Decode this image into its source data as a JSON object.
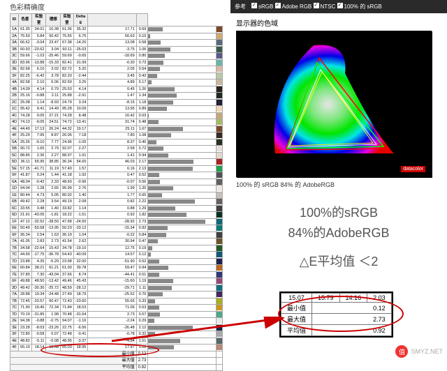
{
  "leftTitle": "色彩精确度",
  "headers": [
    "ID",
    "色差",
    "实验室",
    "理想",
    "实验室",
    "Delta E"
  ],
  "rows": [
    [
      "1A",
      "61.35",
      "34.01",
      "10.38",
      "61.36",
      "35.32",
      "17.71",
      "0.69",
      "#7a4a2a"
    ],
    [
      "2A",
      "75.50",
      "5.84",
      "50.42",
      "75.55",
      "6.75",
      "56.63",
      "0.10",
      "#d1a772"
    ],
    [
      "3A",
      "66.62",
      "-3.04",
      "23.47",
      "67.38",
      "-14.20",
      "13.08",
      "0.58",
      "#5a6a7a"
    ],
    [
      "3B",
      "60.93",
      "-23.62",
      "3.04",
      "60.11",
      "-25.03",
      "-3.75",
      "1.06",
      "#3a5a4a"
    ],
    [
      "3C",
      "59.66",
      "-1.03",
      "-25.46",
      "59.69",
      "-0.65",
      "-18.69",
      "0.80",
      "#5a5a8a"
    ],
    [
      "3D",
      "83.96",
      "-13.88",
      "-15.33",
      "82.41",
      "31.99",
      "-0.30",
      "0.73",
      "#6ab5a5"
    ],
    [
      "3E",
      "82.68",
      "6.10",
      "3.02",
      "82.72",
      "5.20",
      "2.05",
      "0.54",
      "#d8b8a8"
    ],
    [
      "3F",
      "82.25",
      "-6.42",
      "3.78",
      "82.20",
      "-2.44",
      "3.45",
      "0.42",
      "#b8c8a8"
    ],
    [
      "4A",
      "82.58",
      "2.10",
      "6.06",
      "82.59",
      "3.25",
      "4.89",
      "0.17",
      "#c8b8a0"
    ],
    [
      "4B",
      "14.09",
      "4.14",
      "0.79",
      "25.53",
      "4.14",
      "0.45",
      "1.26",
      "#2a2020"
    ],
    [
      "2B",
      "25.16",
      "-0.88",
      "2.11",
      "25.88",
      "-2.91",
      "1.47",
      "1.34",
      "#202820"
    ],
    [
      "2C",
      "25.08",
      "1.14",
      "-8.93",
      "24.79",
      "3.24",
      "-8.15",
      "1.18",
      "#202038"
    ],
    [
      "1C",
      "95.42",
      "9.41",
      "14.49",
      "95.28",
      "10.09",
      "13.95",
      "0.89",
      "#f0d8b8"
    ],
    [
      "4C",
      "74.28",
      "9.05",
      "27.21",
      "74.28",
      "8.48",
      "16.42",
      "0.03",
      "#c8a878"
    ],
    [
      "4D",
      "74.13",
      "-9.05",
      "24.51",
      "74.72",
      "-13.41",
      "31.74",
      "0.48",
      "#a8b868"
    ],
    [
      "4E",
      "44.49",
      "17.13",
      "26.24",
      "44.32",
      "19.17",
      "25.11",
      "1.67",
      "#7a4a2a"
    ],
    [
      "4F",
      "25.29",
      "7.95",
      "8.87",
      "26.06",
      "7.18",
      "7.80",
      "1.08",
      "#3a2820"
    ],
    [
      "5A",
      "25.26",
      "-9.10",
      "7.77",
      "24.96",
      "-1.05",
      "8.37",
      "0.40",
      "#283020"
    ],
    [
      "5B",
      "90.72",
      "1.65",
      "2.79",
      "92.07",
      "2.27",
      "2.58",
      "0.72",
      "#e8e0d8"
    ],
    [
      "5C",
      "88.85",
      "2.36",
      "2.27",
      "88.97",
      "1.91",
      "1.41",
      "0.94",
      "#e0d8d0"
    ],
    [
      "5D",
      "36.11",
      "65.95",
      "38.85",
      "36.34",
      "54.65",
      "46.03",
      "2.17",
      "#a82020"
    ],
    [
      "5E",
      "57.15",
      "-41.71",
      "11.19",
      "57.40",
      "1.57",
      "6.16",
      "2.13",
      "#20a050"
    ],
    [
      "5F",
      "41.87",
      "0.24",
      "1.44",
      "41.18",
      "1.92",
      "0.47",
      "0.52",
      "#505058"
    ],
    [
      "6A",
      "48.04",
      "-0.42",
      "2.33",
      "48.60",
      "-0.96",
      "-0.07",
      "0.56",
      "#606060"
    ],
    [
      "1D",
      "94.04",
      "1.28",
      "2.65",
      "95.99",
      "2.76",
      "1.99",
      "1.20",
      "#f0e8e0"
    ],
    [
      "1E",
      "80.44",
      "4.73",
      "5.05",
      "80.02",
      "1.40",
      "1.77",
      "0.65",
      "#c8c0b8"
    ],
    [
      "6B",
      "49.42",
      "2.28",
      "3.54",
      "49.19",
      "2.08",
      "0.82",
      "2.22",
      "#686060"
    ],
    [
      "6C",
      "33.55",
      "3.48",
      "1.40",
      "33.82",
      "1.14",
      "0.88",
      "1.29",
      "#404040"
    ],
    [
      "6D",
      "21.91",
      "-43.05",
      "-1.81",
      "18.22",
      "-1.51",
      "0.92",
      "1.82",
      "#083020"
    ],
    [
      "1F",
      "47.12",
      "-32.52",
      "-28.50",
      "47.68",
      "-24.50",
      "-28.92",
      "2.73",
      "#106878"
    ],
    [
      "6E",
      "50.49",
      "-53.68",
      "-13.95",
      "50.23",
      "-33.12",
      "-15.34",
      "0.92",
      "#107878"
    ],
    [
      "6F",
      "36.34",
      "2.54",
      "1.63",
      "36.19",
      "1.04",
      "-0.22",
      "0.84",
      "#404040"
    ],
    [
      "7A",
      "41.05",
      "2.83",
      "2.73",
      "41.54",
      "2.62",
      "30.94",
      "0.47",
      "#685828"
    ],
    [
      "7B",
      "34.58",
      "-22.64",
      "15.43",
      "34.78",
      "-19.10",
      "12.75",
      "0.19",
      "#205828"
    ],
    [
      "7C",
      "44.90",
      "-17.75",
      "-36.78",
      "54.43",
      "-40.09",
      "14.57",
      "0.12",
      "#105878"
    ],
    [
      "7D",
      "23.88",
      "4.35",
      "-5.29",
      "23.98",
      "22.00",
      "-51.90",
      "0.52",
      "#202050"
    ],
    [
      "6E",
      "60.84",
      "38.21",
      "61.21",
      "61.00",
      "39.78",
      "59.47",
      "0.94",
      "#b86820"
    ],
    [
      "7E",
      "37.80",
      "7.30",
      "-43.04",
      "37.66",
      "8.74",
      "-44.41",
      "0.51",
      "#303878"
    ],
    [
      "6F",
      "49.88",
      "48.50",
      "-13.42",
      "49.46",
      "45.43",
      "-15.60",
      "1.19",
      "#984878"
    ],
    [
      "3D",
      "49.42",
      "-30.30",
      "-25.72",
      "48.59",
      "-28.12",
      "-29.71",
      "1.11",
      "#107080"
    ],
    [
      "7A",
      "28.88",
      "19.34",
      "-24.48",
      "27.49",
      "18.79",
      "-25.52",
      "0.70",
      "#402860"
    ],
    [
      "7B",
      "72.45",
      "-23.57",
      "60.47",
      "72.43",
      "-23.60",
      "55.65",
      "0.33",
      "#a8b020"
    ],
    [
      "7C",
      "71.90",
      "19.46",
      "72.34",
      "71.84",
      "18.53",
      "71.06",
      "0.53",
      "#c89820"
    ],
    [
      "7D",
      "70.19",
      "-31.85",
      "1.98",
      "70.48",
      "-31.64",
      "2.73",
      "0.57",
      "#50a888"
    ],
    [
      "2E",
      "94.38",
      "-0.88",
      "-0.75",
      "94.07",
      "-1.16",
      "-2.24",
      "0.29",
      "#e8e8e8"
    ],
    [
      "3E",
      "23.28",
      "-8.03",
      "-23.26",
      "22.75",
      "-6.56",
      "-26.48",
      "2.12",
      "#102848"
    ],
    [
      "3F",
      "72.80",
      "-0.58",
      "0.07",
      "72.48",
      "-0.41",
      "-0.78",
      "0.32",
      "#a8a8a8"
    ],
    [
      "4E",
      "48.82",
      "-5.11",
      "-0.08",
      "48.95",
      "-3.37",
      "-4.84",
      "1.51",
      "#586868"
    ],
    [
      "4F",
      "65.10",
      "18.14",
      "18.68",
      "65.03",
      "18.95",
      "17.97",
      "1.22",
      "#b88878"
    ]
  ],
  "summary": [
    [
      "最小值",
      "0.12"
    ],
    [
      "最大值",
      "2.73"
    ],
    [
      "平均值",
      "0.92"
    ]
  ],
  "legend": {
    "ref": "参考",
    "items": [
      "sRGB",
      "Adobe RGB",
      "NTSC",
      "100% 的 sRGB"
    ]
  },
  "gamutTitle": "显示器的色域",
  "gamutCaption": "100% 的 sRGB    84% 的 AdobeRGB",
  "big1": "100%的sRGB",
  "big2": "84%的AdobeRGB",
  "delta": "△E平均值 ＜2",
  "calloutHeader": [
    "15.07",
    "15.79",
    "14.16",
    "2.03"
  ],
  "callout": [
    [
      "最小值",
      "0.12"
    ],
    [
      "最大值",
      "2.73"
    ],
    [
      "平均值",
      "0.92"
    ]
  ],
  "datacolor": "datacolor",
  "wm": {
    "badge": "值",
    "text": "SMYZ.NET"
  }
}
